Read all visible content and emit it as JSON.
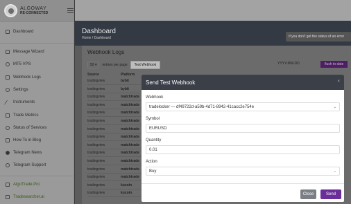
{
  "brand": {
    "name": "ALGOWAY",
    "status": "RE-CONNECTED"
  },
  "sidebar": {
    "items": [
      {
        "label": "Dashboard",
        "icon": "grid-icon"
      },
      {
        "label": "Message Wizard",
        "icon": "document-icon"
      },
      {
        "label": "MT5 VPS",
        "icon": "cloud-icon"
      },
      {
        "label": "Webhook Logs",
        "icon": "list-icon"
      },
      {
        "label": "Settings",
        "icon": "gear-icon"
      },
      {
        "label": "Instruments",
        "icon": "instrument-icon"
      },
      {
        "label": "Trade Metrics",
        "icon": "table-icon"
      },
      {
        "label": "Status of Services",
        "icon": "info-icon"
      },
      {
        "label": "How To in Blog",
        "icon": "book-icon"
      },
      {
        "label": "Telegram News",
        "icon": "telegram-icon"
      },
      {
        "label": "Telegram Support",
        "icon": "support-icon"
      },
      {
        "label": "AlgoTrade.Pro",
        "icon": "link-icon"
      },
      {
        "label": "Tradesearcher.ai",
        "icon": "link-icon"
      }
    ]
  },
  "page": {
    "title": "Dashboard",
    "breadcrumb": "Home / Dashboard",
    "notice": "If you don't get the status of an error"
  },
  "webhook_logs": {
    "title": "Webhook Logs",
    "entries_value": "50",
    "entries_label": "entries per page",
    "test_button": "Test Webhook",
    "date_placeholder": "YYYY-MM-DD",
    "flush_button": "flush to date",
    "columns": {
      "source": "Source",
      "platform": "Platform"
    },
    "rows": [
      {
        "source": "tradingview",
        "platform": "bybit"
      },
      {
        "source": "tradingview",
        "platform": "bybit"
      },
      {
        "source": "tradingview",
        "platform": "matchtrade"
      },
      {
        "source": "tradingview",
        "platform": "matchtrade"
      },
      {
        "source": "tradingview",
        "platform": "matchtrade"
      },
      {
        "source": "tradingview",
        "platform": "matchtrade"
      },
      {
        "source": "tradingview",
        "platform": "matchtrade"
      },
      {
        "source": "tradingview",
        "platform": "matchtrade"
      },
      {
        "source": "tradingview",
        "platform": "matchtrade"
      },
      {
        "source": "tradingview",
        "platform": "matchtrade"
      },
      {
        "source": "tradingview",
        "platform": "matchtrade"
      },
      {
        "source": "tradingview",
        "platform": "matchtrade"
      },
      {
        "source": "tradingview",
        "platform": "matchtrade"
      },
      {
        "source": "tradingview",
        "platform": "kucoin"
      },
      {
        "source": "tradingview",
        "platform": "kucoin"
      }
    ]
  },
  "modal": {
    "title": "Send Test Webhook",
    "close_x": "×",
    "webhook_label": "Webhook",
    "webhook_value": "tradelocker — df49722d-a59b-4d71-8942-41cacc2e754e",
    "symbol_label": "Symbol",
    "symbol_value": "EURUSD",
    "quantity_label": "Quantity",
    "quantity_value": "0.01",
    "action_label": "Action",
    "action_value": "Buy",
    "close_button": "Close",
    "send_button": "Send"
  },
  "colors": {
    "send_button": "#6a2d9a",
    "modal_header": "#3b3f48",
    "flush_button": "#4b1e66"
  }
}
